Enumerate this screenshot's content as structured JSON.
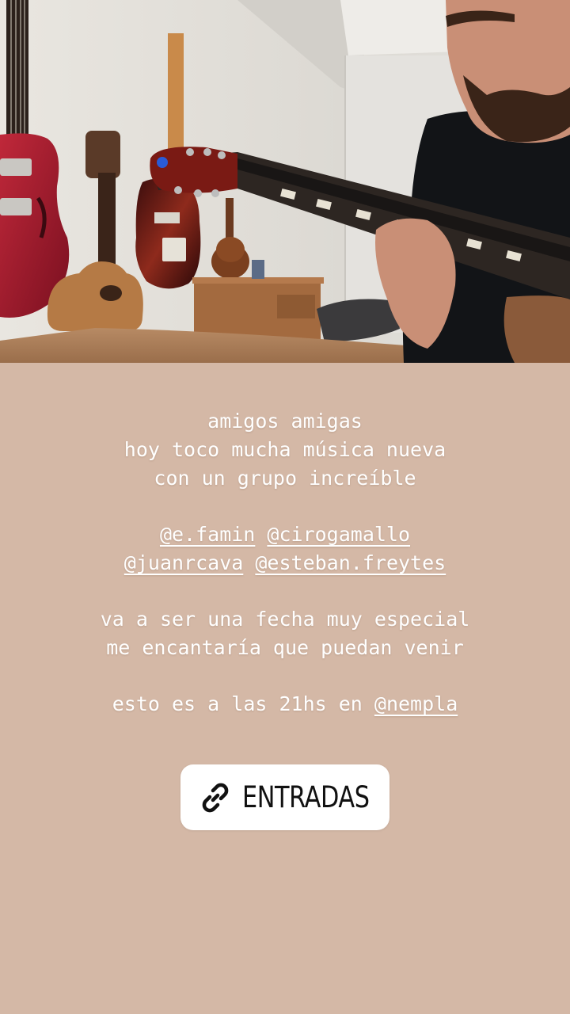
{
  "story": {
    "background_color": "#d4b8a6",
    "photo": {
      "description_icon": "guitar-photo"
    },
    "caption": {
      "l1": "amigos amigas",
      "l2": "hoy toco mucha música nueva",
      "l3": "con un grupo increíble",
      "m1": "@e.famin",
      "m2": "@cirogamallo",
      "m3": "@juanrcava",
      "m4": "@esteban.freytes",
      "l4": "va a ser una fecha muy especial",
      "l5": "me encantaría que puedan venir",
      "l6_prefix": "esto es a las 21hs en ",
      "m5": "@nempla"
    },
    "link_sticker": {
      "icon": "link-icon",
      "label": "ENTRADAS"
    }
  }
}
